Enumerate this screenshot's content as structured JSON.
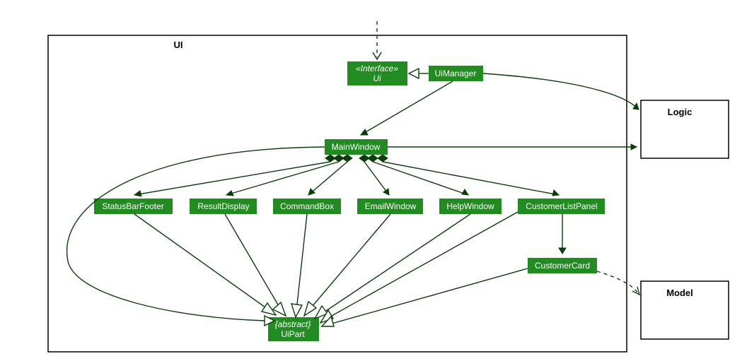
{
  "packages": {
    "ui": {
      "label": "UI"
    },
    "logic": {
      "label": "Logic"
    },
    "model": {
      "label": "Model"
    }
  },
  "nodes": {
    "ui_interface": {
      "stereotype": "«Interface»",
      "name": "Ui"
    },
    "ui_manager": {
      "name": "UiManager"
    },
    "main_window": {
      "name": "MainWindow"
    },
    "status_bar_footer": {
      "name": "StatusBarFooter"
    },
    "result_display": {
      "name": "ResultDisplay"
    },
    "command_box": {
      "name": "CommandBox"
    },
    "email_window": {
      "name": "EmailWindow"
    },
    "help_window": {
      "name": "HelpWindow"
    },
    "customer_list_panel": {
      "name": "CustomerListPanel"
    },
    "customer_card": {
      "name": "CustomerCard"
    },
    "ui_part": {
      "stereotype": "{abstract}",
      "name": "UiPart"
    }
  },
  "edges": [
    {
      "from": "external_top",
      "to": "ui_interface",
      "type": "dependency"
    },
    {
      "from": "ui_manager",
      "to": "ui_interface",
      "type": "realization"
    },
    {
      "from": "ui_manager",
      "to": "main_window",
      "type": "association_arrow"
    },
    {
      "from": "ui_manager",
      "to": "logic",
      "type": "association_arrow"
    },
    {
      "from": "main_window",
      "to": "logic",
      "type": "association_arrow"
    },
    {
      "from": "main_window",
      "to": "status_bar_footer",
      "type": "composition"
    },
    {
      "from": "main_window",
      "to": "result_display",
      "type": "composition"
    },
    {
      "from": "main_window",
      "to": "command_box",
      "type": "composition"
    },
    {
      "from": "main_window",
      "to": "email_window",
      "type": "composition"
    },
    {
      "from": "main_window",
      "to": "help_window",
      "type": "composition"
    },
    {
      "from": "main_window",
      "to": "customer_list_panel",
      "type": "composition"
    },
    {
      "from": "customer_list_panel",
      "to": "customer_card",
      "type": "association_arrow"
    },
    {
      "from": "customer_card",
      "to": "model",
      "type": "dependency"
    },
    {
      "from": "main_window",
      "to": "ui_part",
      "type": "generalization"
    },
    {
      "from": "status_bar_footer",
      "to": "ui_part",
      "type": "generalization"
    },
    {
      "from": "result_display",
      "to": "ui_part",
      "type": "generalization"
    },
    {
      "from": "command_box",
      "to": "ui_part",
      "type": "generalization"
    },
    {
      "from": "email_window",
      "to": "ui_part",
      "type": "generalization"
    },
    {
      "from": "help_window",
      "to": "ui_part",
      "type": "generalization"
    },
    {
      "from": "customer_list_panel",
      "to": "ui_part",
      "type": "generalization"
    },
    {
      "from": "customer_card",
      "to": "ui_part",
      "type": "generalization"
    }
  ]
}
